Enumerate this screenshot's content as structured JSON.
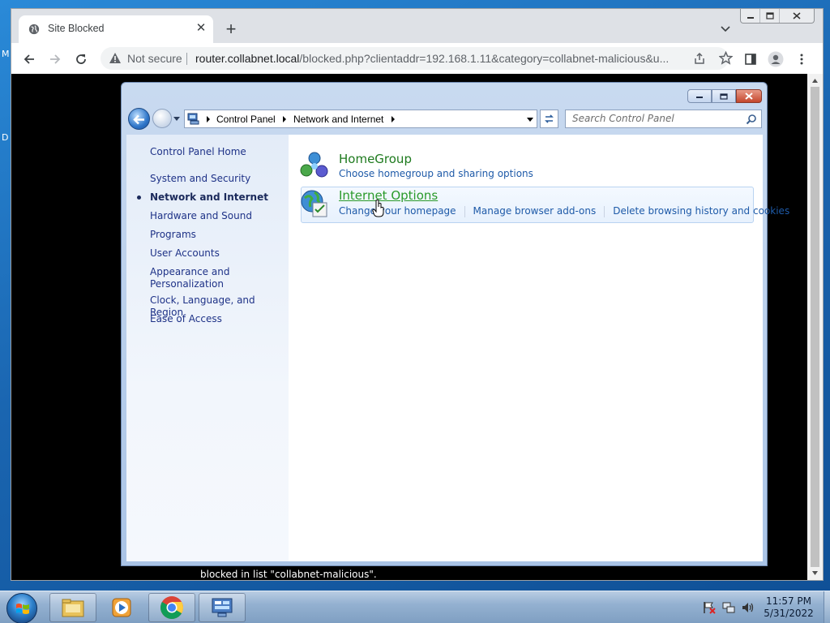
{
  "desktop": {
    "edge_text_top": "M",
    "edge_text_mid": "D"
  },
  "browser": {
    "tab": {
      "title": "Site Blocked"
    },
    "omnibox": {
      "security_label": "Not secure",
      "url_host": "router.collabnet.local",
      "url_path": "/blocked.php?clientaddr=192.168.1.11&category=collabnet-malicious&u..."
    },
    "blocked_message": "blocked in list \"collabnet-malicious\"."
  },
  "control_panel": {
    "breadcrumbs": [
      "Control Panel",
      "Network and Internet"
    ],
    "search_placeholder": "Search Control Panel",
    "sidebar": {
      "home": "Control Panel Home",
      "items": [
        {
          "label": "System and Security"
        },
        {
          "label": "Network and Internet",
          "active": true
        },
        {
          "label": "Hardware and Sound"
        },
        {
          "label": "Programs"
        },
        {
          "label": "User Accounts"
        },
        {
          "label": "Appearance and Personalization"
        },
        {
          "label": "Clock, Language, and Region"
        },
        {
          "label": "Ease of Access"
        }
      ]
    },
    "categories": [
      {
        "title": "HomeGroup",
        "links": [
          "Choose homegroup and sharing options"
        ]
      },
      {
        "title": "Internet Options",
        "links": [
          "Change your homepage",
          "Manage browser add-ons",
          "Delete browsing history and cookies"
        ]
      }
    ]
  },
  "taskbar": {
    "clock": {
      "time": "11:57 PM",
      "date": "5/31/2022"
    }
  }
}
